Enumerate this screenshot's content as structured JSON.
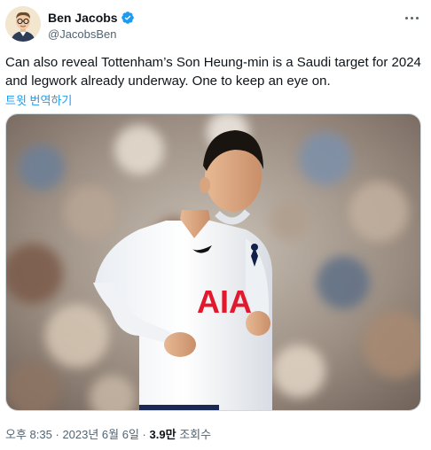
{
  "author": {
    "display_name": "Ben Jacobs",
    "handle": "@JacobsBen",
    "verified": true,
    "avatar_icon": "avatar-illustration"
  },
  "more_icon": "more-horizontal-icon",
  "tweet": {
    "text_line1": "Can also reveal Tottenham’s Son Heung-min is a Saudi target for 2024",
    "text_line2": "and legwork already underway. One to keep an eye on.",
    "translate_label": "트윗 번역하기"
  },
  "media": {
    "shirt_sponsor": "AIA"
  },
  "meta": {
    "time": "오후 8:35",
    "sep1": "·",
    "date": "2023년 6월 6일",
    "sep2": "·",
    "views_count": "3.9만",
    "views_label": "조회수"
  },
  "colors": {
    "accent": "#1d9bf0",
    "text_primary": "#0f1419",
    "text_secondary": "#536471",
    "sponsor_red": "#e2192c"
  }
}
